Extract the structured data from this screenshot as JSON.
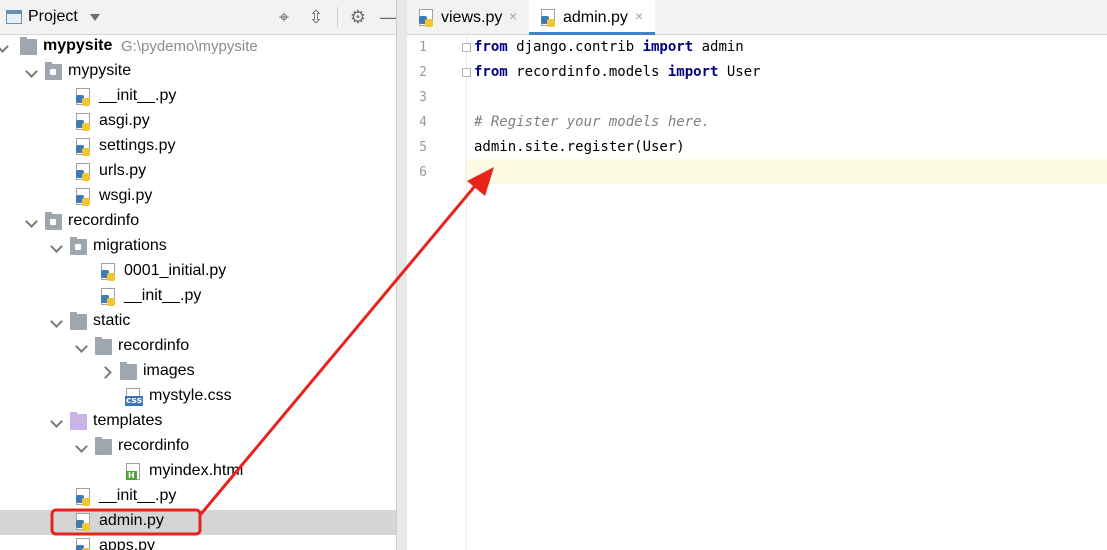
{
  "project_panel": {
    "title": "Project",
    "toolbar_icons": [
      "locate-icon",
      "collapse-all-icon",
      "gear-icon",
      "minimize-icon"
    ],
    "tree": [
      {
        "depth": 0,
        "label": "mypysite",
        "hint": "G:\\pydemo\\mypysite",
        "type": "root-folder",
        "expanded": true
      },
      {
        "depth": 1,
        "label": "mypysite",
        "type": "package",
        "expanded": true
      },
      {
        "depth": 2,
        "label": "__init__.py",
        "type": "py"
      },
      {
        "depth": 2,
        "label": "asgi.py",
        "type": "py"
      },
      {
        "depth": 2,
        "label": "settings.py",
        "type": "py"
      },
      {
        "depth": 2,
        "label": "urls.py",
        "type": "py"
      },
      {
        "depth": 2,
        "label": "wsgi.py",
        "type": "py"
      },
      {
        "depth": 1,
        "label": "recordinfo",
        "type": "package",
        "expanded": true
      },
      {
        "depth": 2,
        "label": "migrations",
        "type": "package",
        "expanded": true
      },
      {
        "depth": 3,
        "label": "0001_initial.py",
        "type": "py"
      },
      {
        "depth": 3,
        "label": "__init__.py",
        "type": "py"
      },
      {
        "depth": 2,
        "label": "static",
        "type": "folder",
        "expanded": true
      },
      {
        "depth": 3,
        "label": "recordinfo",
        "type": "folder",
        "expanded": true
      },
      {
        "depth": 4,
        "label": "images",
        "type": "folder",
        "expanded": false
      },
      {
        "depth": 4,
        "label": "mystyle.css",
        "type": "css"
      },
      {
        "depth": 2,
        "label": "templates",
        "type": "template-folder",
        "expanded": true
      },
      {
        "depth": 3,
        "label": "recordinfo",
        "type": "folder",
        "expanded": true
      },
      {
        "depth": 4,
        "label": "myindex.html",
        "type": "html"
      },
      {
        "depth": 2,
        "label": "__init__.py",
        "type": "py"
      },
      {
        "depth": 2,
        "label": "admin.py",
        "type": "py",
        "selected": true
      },
      {
        "depth": 2,
        "label": "apps.py",
        "type": "py"
      }
    ]
  },
  "editor": {
    "tabs": [
      {
        "label": "views.py",
        "active": false
      },
      {
        "label": "admin.py",
        "active": true
      }
    ],
    "close_glyph": "×",
    "lines": [
      {
        "n": "1",
        "tokens": [
          {
            "t": "from",
            "k": "kw"
          },
          {
            "t": " django.contrib ",
            "k": ""
          },
          {
            "t": "import",
            "k": "kw"
          },
          {
            "t": " admin",
            "k": ""
          }
        ]
      },
      {
        "n": "2",
        "tokens": [
          {
            "t": "from",
            "k": "kw"
          },
          {
            "t": " recordinfo.models ",
            "k": ""
          },
          {
            "t": "import",
            "k": "kw"
          },
          {
            "t": " User",
            "k": ""
          }
        ]
      },
      {
        "n": "3",
        "tokens": []
      },
      {
        "n": "4",
        "tokens": [
          {
            "t": "# Register your models here.",
            "k": "cm"
          }
        ]
      },
      {
        "n": "5",
        "tokens": [
          {
            "t": "admin.site.register(User)",
            "k": ""
          }
        ]
      },
      {
        "n": "6",
        "tokens": []
      }
    ],
    "current_line": 6
  },
  "annotation": {
    "color": "#e8231b",
    "highlighted_item": "admin.py"
  }
}
